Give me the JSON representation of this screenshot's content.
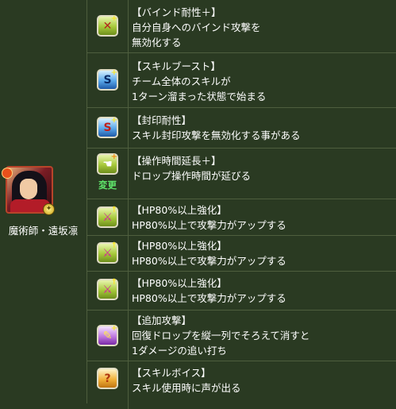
{
  "character": {
    "name": "魔術師・遠坂凛",
    "attribute_icon": "light-attribute-icon"
  },
  "awakenings": [
    {
      "icon": "bind-resist-icon",
      "title": "【バインド耐性＋】",
      "desc": [
        "自分自身へのバインド攻撃を",
        "無効化する"
      ]
    },
    {
      "icon": "skill-boost-icon",
      "title": "【スキルブースト】",
      "desc": [
        "チーム全体のスキルが",
        "1ターン溜まった状態で始まる"
      ]
    },
    {
      "icon": "seal-resist-icon",
      "title": "【封印耐性】",
      "desc": [
        "スキル封印攻撃を無効化する事がある"
      ]
    },
    {
      "icon": "time-extend-plus-icon",
      "title": "【操作時間延長＋】",
      "desc": [
        "ドロップ操作時間が延びる"
      ],
      "change": "変更"
    },
    {
      "icon": "hp80-enhance-icon",
      "title": "【HP80%以上強化】",
      "desc": [
        "HP80%以上で攻撃力がアップする"
      ]
    },
    {
      "icon": "hp80-enhance-icon",
      "title": "【HP80%以上強化】",
      "desc": [
        "HP80%以上で攻撃力がアップする"
      ]
    },
    {
      "icon": "hp80-enhance-icon",
      "title": "【HP80%以上強化】",
      "desc": [
        "HP80%以上で攻撃力がアップする"
      ]
    },
    {
      "icon": "extra-attack-icon",
      "title": "【追加攻撃】",
      "desc": [
        "回復ドロップを縦一列でそろえて消すと",
        "1ダメージの追い打ち"
      ]
    },
    {
      "icon": "skill-voice-icon",
      "title": "【スキルボイス】",
      "desc": [
        "スキル使用時に声が出る"
      ]
    }
  ]
}
